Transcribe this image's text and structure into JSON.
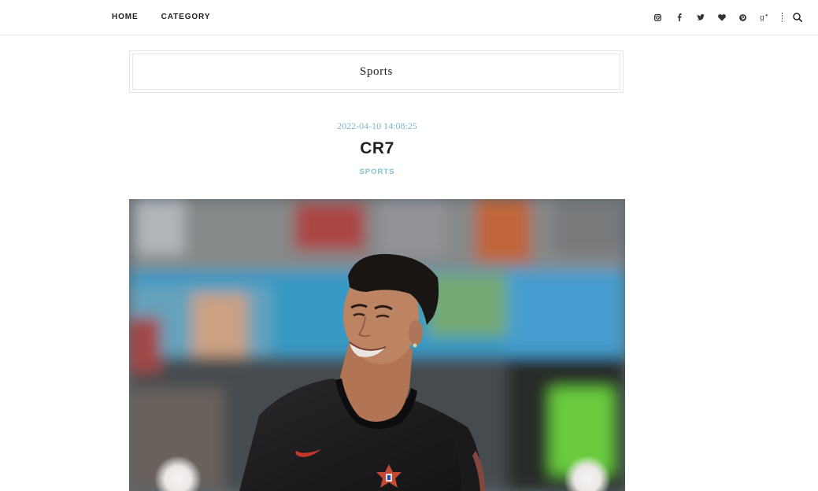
{
  "nav": {
    "items": [
      {
        "label": "HOME"
      },
      {
        "label": "CATEGORY"
      }
    ]
  },
  "social": {
    "icons": [
      "instagram-icon",
      "facebook-icon",
      "twitter-icon",
      "heart-icon",
      "pinterest-icon",
      "google-plus-icon"
    ],
    "search_icon": "search-icon"
  },
  "category_box": {
    "title": "Sports"
  },
  "post": {
    "date": "2022-04-10 14:08:25",
    "title": "CR7",
    "category": "SPORTS",
    "image_alt": "Smiling football player in a black jersey"
  },
  "colors": {
    "accent": "#7fb7c0",
    "text": "#222222",
    "border": "#e6e6e6"
  }
}
